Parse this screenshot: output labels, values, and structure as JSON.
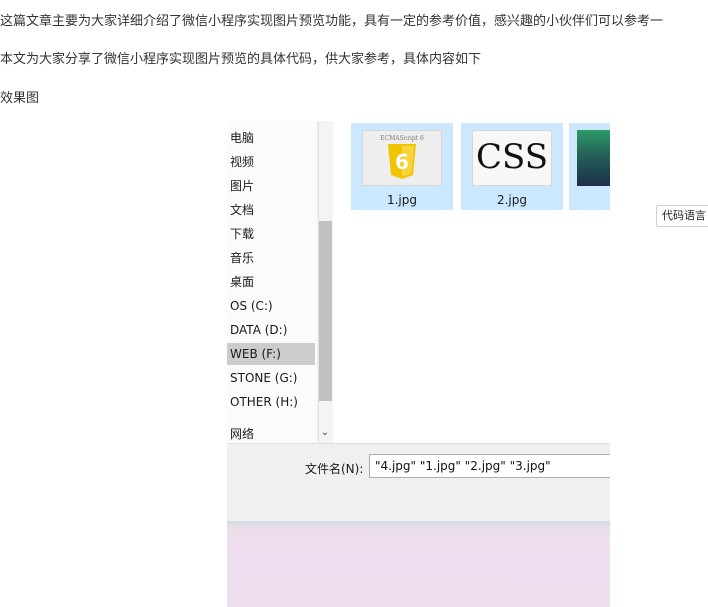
{
  "article": {
    "p1": "这篇文章主要为大家详细介绍了微信小程序实现图片预览功能，具有一定的参考价值，感兴趣的小伙伴们可以参考一",
    "p2": "本文为大家分享了微信小程序实现图片预览的具体代码，供大家参考，具体内容如下",
    "p3": "效果图"
  },
  "code_lang_label": "代码语言",
  "dialog": {
    "nav_items": [
      "电脑",
      "视频",
      "图片",
      "文档",
      "下载",
      "音乐",
      "桌面",
      "OS (C:)",
      "DATA (D:)",
      "WEB (F:)",
      "STONE (G:)",
      "OTHER (H:)",
      "网络"
    ],
    "selected_nav": "WEB (F:)",
    "files": [
      {
        "name": "1.jpg",
        "thumb_text": "ECMAScript 6",
        "badge": "6"
      },
      {
        "name": "2.jpg",
        "thumb_text": "CSS"
      }
    ],
    "filename_label": "文件名(N):",
    "filename_value": "\"4.jpg\" \"1.jpg\" \"2.jpg\" \"3.jpg\""
  },
  "colors": {
    "selection": "#cce8ff",
    "nav_selected": "#cccccc",
    "dialog_bg": "#f0f0f0"
  }
}
